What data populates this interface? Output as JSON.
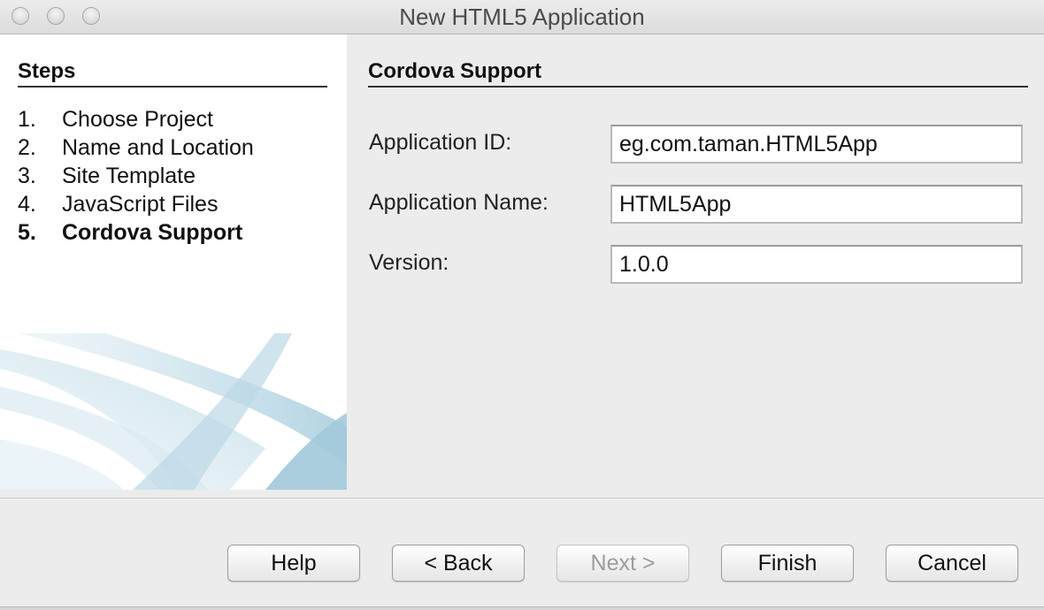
{
  "window": {
    "title": "New HTML5 Application"
  },
  "steps": {
    "title": "Steps",
    "items": [
      {
        "num": "1.",
        "label": "Choose Project"
      },
      {
        "num": "2.",
        "label": "Name and Location"
      },
      {
        "num": "3.",
        "label": "Site Template"
      },
      {
        "num": "4.",
        "label": "JavaScript Files"
      },
      {
        "num": "5.",
        "label": "Cordova Support"
      }
    ],
    "current_index": 4
  },
  "content": {
    "title": "Cordova Support",
    "fields": {
      "app_id": {
        "label": "Application ID:",
        "value": "eg.com.taman.HTML5App"
      },
      "app_name": {
        "label": "Application Name:",
        "value": "HTML5App"
      },
      "version": {
        "label": "Version:",
        "value": "1.0.0"
      }
    }
  },
  "buttons": {
    "help": "Help",
    "back": "< Back",
    "next": "Next >",
    "finish": "Finish",
    "cancel": "Cancel"
  },
  "colors": {
    "window_bg": "#ececec",
    "panel_bg": "#ffffff",
    "swoosh_blue": "#a9cede",
    "disabled_text": "#9c9c9c"
  }
}
